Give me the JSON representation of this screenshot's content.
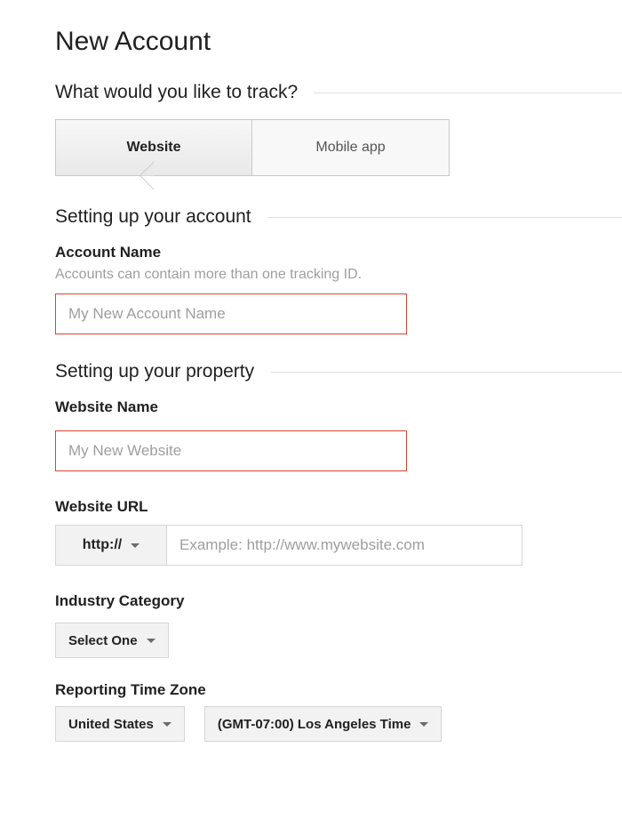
{
  "page": {
    "title": "New Account"
  },
  "sections": {
    "track_heading": "What would you like to track?",
    "account_heading": "Setting up your account",
    "property_heading": "Setting up your property"
  },
  "tabs": {
    "website": "Website",
    "mobile": "Mobile app"
  },
  "account": {
    "name_label": "Account Name",
    "name_help": "Accounts can contain more than one tracking ID.",
    "name_placeholder": "My New Account Name"
  },
  "property": {
    "website_name_label": "Website Name",
    "website_name_placeholder": "My New Website",
    "website_url_label": "Website URL",
    "protocol_selected": "http://",
    "website_url_placeholder": "Example: http://www.mywebsite.com",
    "industry_label": "Industry Category",
    "industry_selected": "Select One",
    "timezone_label": "Reporting Time Zone",
    "timezone_country": "United States",
    "timezone_value": "(GMT-07:00) Los Angeles Time"
  }
}
